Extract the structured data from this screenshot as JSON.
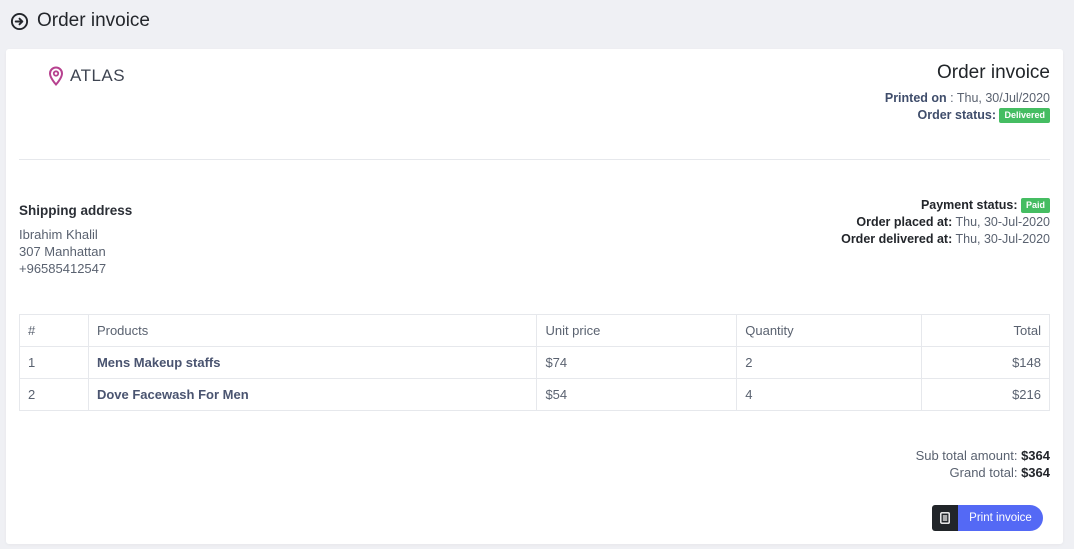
{
  "header": {
    "title": "Order invoice",
    "back_icon": "circle-arrow-right-icon"
  },
  "brand": {
    "name": "ATLAS",
    "logo_icon": "map-pin-icon",
    "color": "#b7418f"
  },
  "invoice": {
    "title": "Order invoice",
    "printed_on_label": "Printed on",
    "printed_on_value": " : Thu, 30/Jul/2020",
    "order_status_label": "Order status:",
    "order_status_badge": "Delivered"
  },
  "shipping": {
    "title": "Shipping address",
    "name": "Ibrahim Khalil",
    "address": "307 Manhattan",
    "phone": "+96585412547"
  },
  "payment": {
    "status_label": "Payment status:",
    "status_badge": "Paid",
    "placed_label": "Order placed at:",
    "placed_value": " Thu, 30-Jul-2020",
    "delivered_label": "Order delivered at:",
    "delivered_value": " Thu, 30-Jul-2020"
  },
  "table": {
    "headers": [
      "#",
      "Products",
      "Unit price",
      "Quantity",
      "Total"
    ],
    "rows": [
      [
        "1",
        "Mens Makeup staffs",
        "$74",
        "2",
        "$148"
      ],
      [
        "2",
        "Dove Facewash For Men",
        "$54",
        "4",
        "$216"
      ]
    ]
  },
  "totals": {
    "subtotal_label": "Sub total amount: ",
    "subtotal_value": "$364",
    "grand_label": "Grand total: ",
    "grand_value": "$364"
  },
  "actions": {
    "print_label": "Print invoice",
    "print_icon": "document-icon"
  },
  "colors": {
    "accent": "#5469f5",
    "success": "#45bd62",
    "dark": "#212529"
  }
}
